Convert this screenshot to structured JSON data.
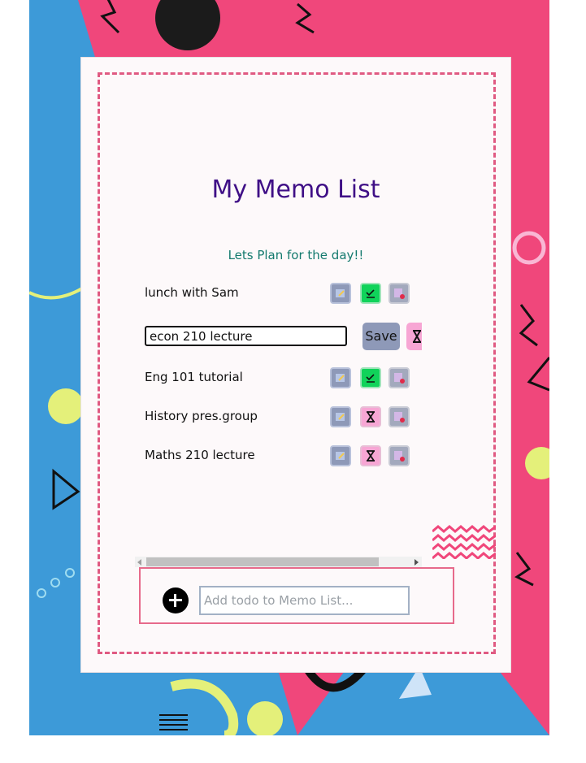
{
  "page": {
    "title": "My Memo List",
    "subtitle": "Lets Plan for the day!!"
  },
  "todos": [
    {
      "text": "lunch with Sam",
      "status": "done",
      "icons": [
        "edit-icon",
        "check-icon",
        "delete-icon"
      ]
    },
    {
      "text": "econ 210 lecture",
      "editing": true,
      "save_label": "Save",
      "icons": [
        "hourglass-icon"
      ]
    },
    {
      "text": "Eng 101 tutorial",
      "status": "done",
      "icons": [
        "edit-icon",
        "check-icon",
        "delete-icon"
      ]
    },
    {
      "text": "History pres.group",
      "status": "pending",
      "icons": [
        "edit-icon",
        "hourglass-icon",
        "delete-icon"
      ]
    },
    {
      "text": "Maths 210 lecture",
      "status": "pending",
      "icons": [
        "edit-icon",
        "hourglass-icon",
        "delete-icon"
      ]
    }
  ],
  "add": {
    "placeholder": "Add todo to Memo List...",
    "button_icon": "plus-circle-icon"
  },
  "colors": {
    "title": "#3f0f86",
    "subtitle": "#147a6e",
    "accent_pink": "#e05a82",
    "done_green": "#10d35a",
    "pending_pink": "#f7a6d4",
    "background_pink": "#f0477b",
    "background_blue": "#3d9ad8"
  }
}
